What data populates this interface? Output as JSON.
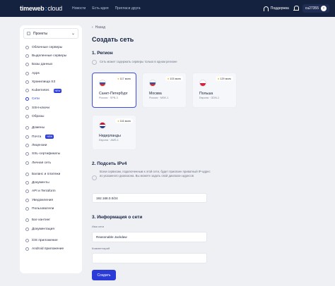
{
  "topbar": {
    "logo_main": "timeweb",
    "logo_sep": ":",
    "logo_cloud": "cloud",
    "nav": [
      "Новости",
      "Есть идея",
      "Пригласи друга"
    ],
    "support": "Поддержка",
    "account": "cu27355"
  },
  "sidebar": {
    "projects_label": "Проекты",
    "groups": [
      [
        {
          "label": "Облачные серверы",
          "badge": ""
        },
        {
          "label": "Выделенные серверы",
          "badge": ""
        },
        {
          "label": "Базы данных",
          "badge": ""
        },
        {
          "label": "Apps",
          "badge": ""
        },
        {
          "label": "Хранилища S3",
          "badge": ""
        },
        {
          "label": "Kubernetes",
          "badge": "NEW"
        },
        {
          "label": "Сети",
          "badge": "",
          "active": true
        },
        {
          "label": "SSH-ключи",
          "badge": ""
        },
        {
          "label": "Образы",
          "badge": ""
        }
      ],
      [
        {
          "label": "Домены",
          "badge": ""
        },
        {
          "label": "Почта",
          "badge": "NEW"
        },
        {
          "label": "Лицензии",
          "badge": ""
        },
        {
          "label": "SSL-сертификаты",
          "badge": ""
        },
        {
          "label": "Личная сеть",
          "badge": ""
        }
      ],
      [
        {
          "label": "Баланс и платежи",
          "badge": ""
        },
        {
          "label": "Документы",
          "badge": ""
        },
        {
          "label": "API и Terraform",
          "badge": ""
        },
        {
          "label": "Уведомления",
          "badge": ""
        },
        {
          "label": "Пользователи",
          "badge": ""
        }
      ],
      [
        {
          "label": "Баг-хантинг",
          "badge": ""
        },
        {
          "label": "Документация",
          "badge": ""
        }
      ],
      [
        {
          "label": "iOS приложение",
          "badge": ""
        },
        {
          "label": "Android приложение",
          "badge": ""
        }
      ]
    ]
  },
  "main": {
    "back": "Назад",
    "title": "Создать сеть",
    "region_section": "1. Регион",
    "region_hint": "Сеть может содержать серверы только в одном регионе",
    "regions": [
      {
        "name": "Санкт-Петербург",
        "code": "Россия · SPB-3",
        "ping": "117 мсек",
        "flag": "ru",
        "selected": true
      },
      {
        "name": "Москва",
        "code": "Россия · MSK-1",
        "ping": "103 мсек",
        "flag": "ru",
        "selected": false
      },
      {
        "name": "Польша",
        "code": "Европа · GDN-1",
        "ping": "129 мсек",
        "flag": "pl",
        "selected": false
      },
      {
        "name": "Нидерланды",
        "code": "Европа · AMS-1",
        "ping": "116 мсек",
        "flag": "nl",
        "selected": false
      }
    ],
    "subnet_section": "2. Подсеть IPv4",
    "subnet_hint": "Всем сервисам, подключенным к этой сети, будет присвоен приватный IP-адрес из указанного диапазона. Вы можете задать свой диапазон адресов",
    "subnet_value": "192.168.0.0/24",
    "info_section": "3. Информация о сети",
    "name_label": "Имя сети",
    "name_value": "Reasonable Jackdaw",
    "comment_label": "Комментарий",
    "comment_value": "",
    "create_button": "Создать"
  },
  "colors": {
    "topbar_bg": "#14213f",
    "accent": "#2b3bd8",
    "page_bg": "#eef0f4"
  }
}
